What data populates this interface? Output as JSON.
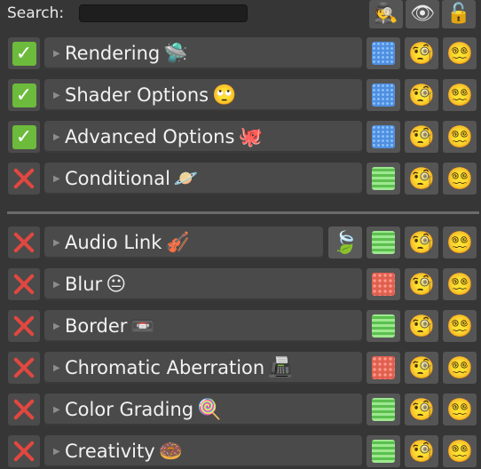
{
  "header": {
    "search_label": "Search:",
    "search_value": "",
    "search_placeholder": "",
    "buttons": [
      {
        "name": "incognito-icon",
        "glyph": "🕵"
      },
      {
        "name": "eye-icon",
        "glyph": "👁"
      },
      {
        "name": "unlock-icon",
        "glyph": "🔓"
      }
    ]
  },
  "modules": [
    {
      "label": "Rendering",
      "emoji": "🛸",
      "enabled": true,
      "swatch": "blue"
    },
    {
      "label": "Shader Options",
      "emoji": "🙄",
      "enabled": true,
      "swatch": "blue"
    },
    {
      "label": "Advanced Options",
      "emoji": "🐙",
      "enabled": true,
      "swatch": "blue"
    },
    {
      "label": "Conditional",
      "emoji": "🪐",
      "enabled": false,
      "swatch": "green"
    },
    {
      "label": "Audio Link",
      "emoji": "🎻",
      "enabled": false,
      "swatch": "green",
      "extra_icon": "🍃"
    },
    {
      "label": "Blur",
      "emoji": "😐",
      "enabled": false,
      "swatch": "red"
    },
    {
      "label": "Border",
      "emoji": "📼",
      "enabled": false,
      "swatch": "green"
    },
    {
      "label": "Chromatic Aberration",
      "emoji": "📠",
      "enabled": false,
      "swatch": "red"
    },
    {
      "label": "Color Grading",
      "emoji": "🍭",
      "enabled": false,
      "swatch": "green"
    },
    {
      "label": "Creativity",
      "emoji": "🍩",
      "enabled": false,
      "swatch": "green"
    }
  ],
  "row_icons": {
    "monocle": "🧐",
    "dizzy": "😵‍💫"
  },
  "colors": {
    "check_on": "#6dbb3c",
    "check_off": "#e2473f",
    "swatch_blue": "#4f8fe0",
    "swatch_green": "#6fcf62",
    "swatch_red": "#e06050"
  }
}
